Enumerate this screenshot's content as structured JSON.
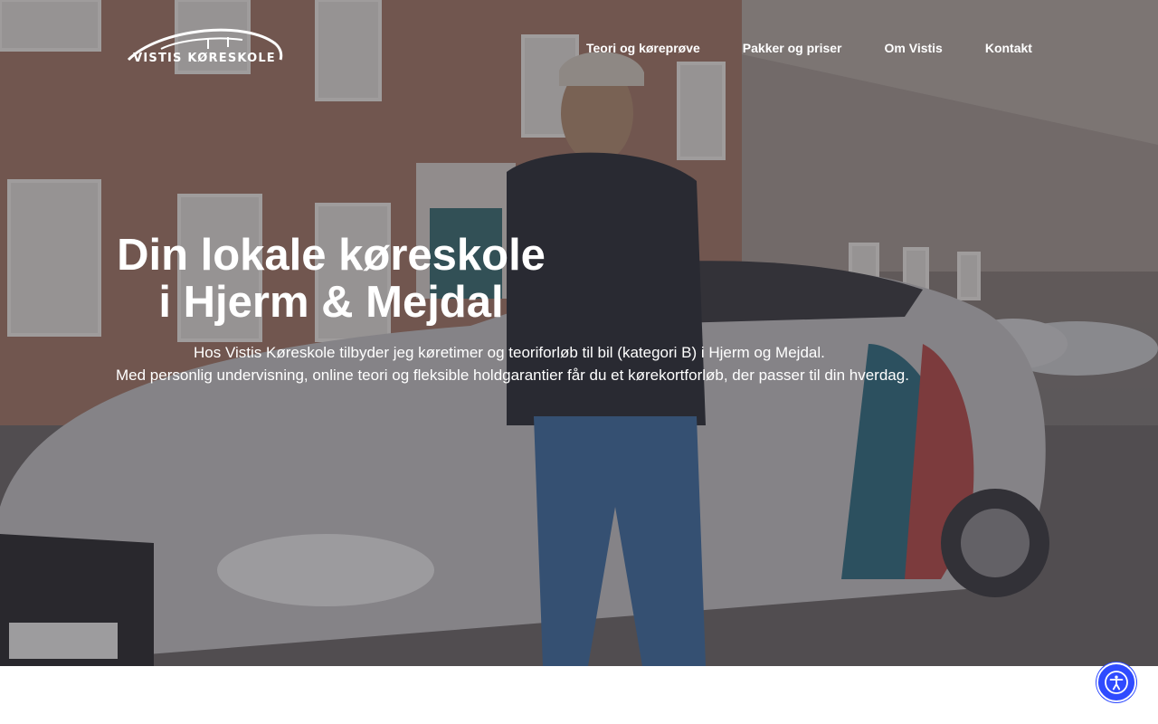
{
  "brand": {
    "logo_text": "VISTIS KØRESKOLE"
  },
  "nav": {
    "items": [
      {
        "label": "Teori og køreprøve"
      },
      {
        "label": "Pakker og priser"
      },
      {
        "label": "Om Vistis"
      },
      {
        "label": "Kontakt"
      }
    ]
  },
  "hero": {
    "title": "Din lokale køreskole i Hjerm & Mejdal",
    "text_line1": "Hos Vistis Køreskole tilbyder jeg køretimer og teoriforløb til bil (kategori B) i Hjerm og Mejdal.",
    "text_line2": "Med personlig undervisning, online teori og fleksible holdgarantier får du et kørekortforløb, der passer til din hverdag."
  },
  "icons": {
    "accessibility": "accessibility-person-icon",
    "logo": "car-outline-logo"
  },
  "colors": {
    "accessibility_button": "#2f4bff",
    "text": "#ffffff"
  }
}
